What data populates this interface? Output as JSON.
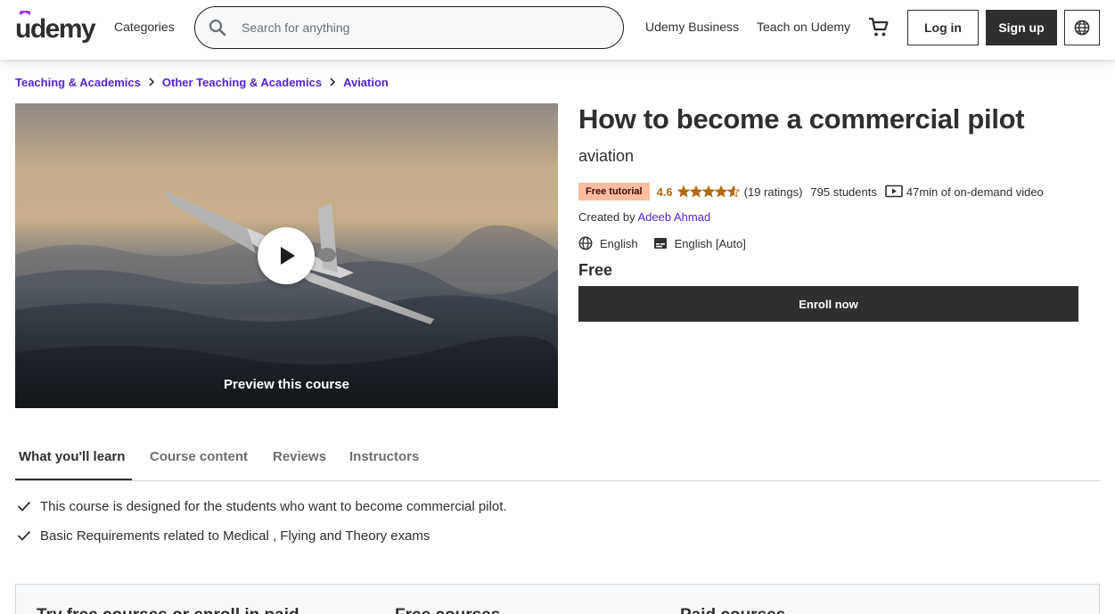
{
  "header": {
    "logo_text": "udemy",
    "categories_label": "Categories",
    "search_placeholder": "Search for anything",
    "business_label": "Udemy Business",
    "teach_label": "Teach on Udemy",
    "login_label": "Log in",
    "signup_label": "Sign up",
    "cart_icon": "cart-icon",
    "language_icon": "globe-icon"
  },
  "breadcrumb": [
    "Teaching & Academics",
    "Other Teaching & Academics",
    "Aviation"
  ],
  "preview": {
    "label": "Preview this course",
    "play_icon": "play-icon"
  },
  "course": {
    "title": "How to become a commercial pilot",
    "subtitle": "aviation",
    "badge": "Free tutorial",
    "rating": "4.6",
    "rating_value": 4.6,
    "ratings_count": "(19 ratings)",
    "students": "795 students",
    "video": "47min of on-demand video",
    "created_by_label": "Created by",
    "author": "Adeeb Ahmad",
    "language": "English",
    "captions": "English [Auto]",
    "price": "Free",
    "enroll_label": "Enroll now"
  },
  "tabs": [
    "What you'll learn",
    "Course content",
    "Reviews",
    "Instructors"
  ],
  "learn": [
    "This course is designed for the students who want to become commercial pilot.",
    "Basic Requirements related to Medical , Flying and Theory exams"
  ],
  "bottom": {
    "col1": "Try free courses or enroll in paid",
    "col2": "Free courses",
    "col3": "Paid courses"
  },
  "colors": {
    "brand_purple": "#5624d0",
    "dark": "#2d2f31",
    "badge_bg": "#fcbca0",
    "rating_orange": "#b4690e"
  }
}
